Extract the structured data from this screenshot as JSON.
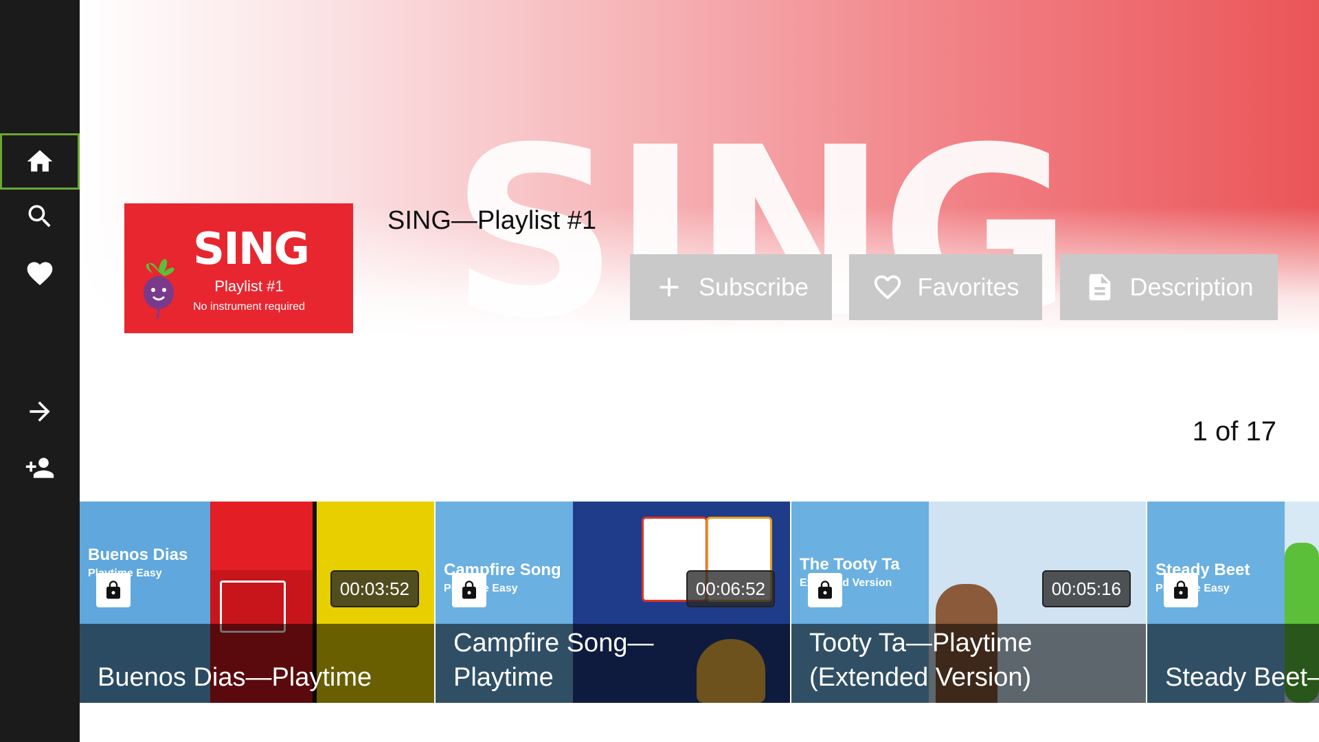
{
  "sidebar": {
    "items": [
      {
        "name": "home",
        "icon": "home-icon",
        "active": true
      },
      {
        "name": "search",
        "icon": "search-icon"
      },
      {
        "name": "favorites",
        "icon": "heart-icon"
      },
      {
        "name": "sign-in",
        "icon": "arrow-right-icon"
      },
      {
        "name": "add-user",
        "icon": "person-add-icon"
      }
    ]
  },
  "hero": {
    "watermark": "SING",
    "thumbnail": {
      "logo": "SING",
      "line1": "Playlist #1",
      "line2": "No instrument required"
    },
    "title": "SING—Playlist #1",
    "buttons": {
      "subscribe": "Subscribe",
      "favorites": "Favorites",
      "description": "Description"
    }
  },
  "counter": "1 of 17",
  "cards": [
    {
      "title": "Buenos Dias—Playtime",
      "brand": "Buenos Dias",
      "brand_sub": "Playtime Easy",
      "duration": "00:03:52",
      "locked": true
    },
    {
      "title": "Campfire Song—\nPlaytime",
      "brand": "Campfire Song",
      "brand_sub": "Playtime Easy",
      "duration": "00:06:52",
      "locked": true
    },
    {
      "title": "Tooty Ta—Playtime\n(Extended Version)",
      "brand": "The Tooty Ta",
      "brand_sub": "Extended Version",
      "duration": "00:05:16",
      "locked": true
    },
    {
      "title": "Steady Beet–",
      "brand": "Steady Beet",
      "brand_sub": "Playtime Easy",
      "duration": "",
      "locked": true
    }
  ],
  "colors": {
    "sidebar": "#1b1b1b",
    "active_outline": "#6aa832",
    "brand_red": "#e8262f",
    "button_gray": "#c9c9c9"
  }
}
